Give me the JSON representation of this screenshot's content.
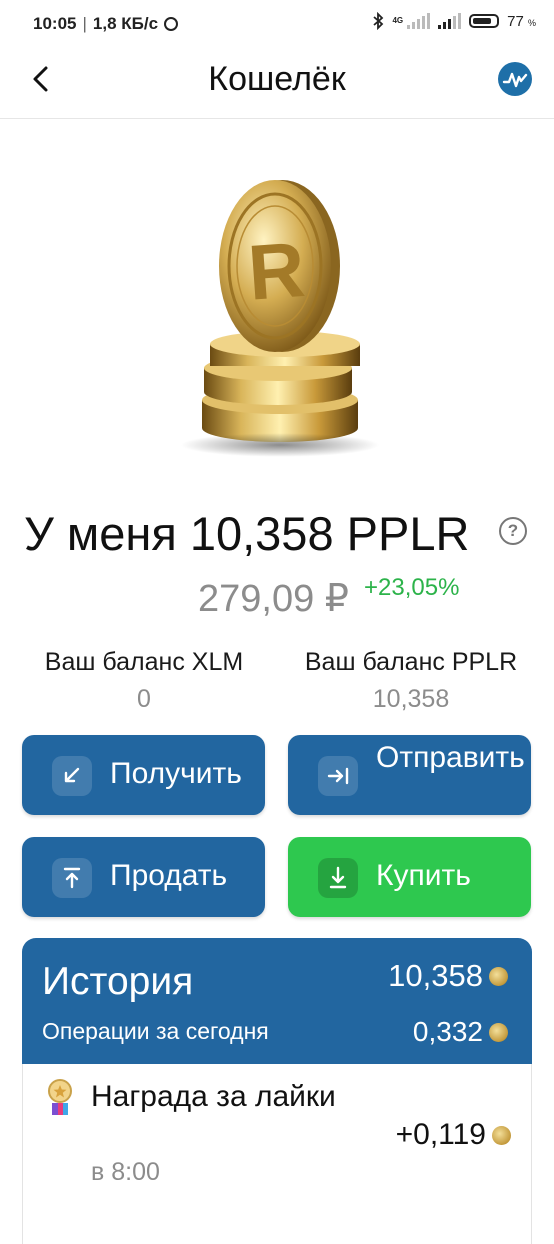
{
  "statusbar": {
    "time": "10:05",
    "speed": "1,8 КБ/с",
    "network": "4G",
    "battery": "77",
    "battery_unit": "%"
  },
  "header": {
    "title": "Кошелёк"
  },
  "wallet": {
    "balance_text": "У меня 10,358 PPLR",
    "help_symbol": "?",
    "rub_value": "279,09 ₽",
    "change": "+23,05%",
    "xlm_label": "Ваш баланс XLM",
    "xlm_value": "0",
    "pplr_label": "Ваш баланс PPLR",
    "pplr_value": "10,358"
  },
  "actions": {
    "receive": "Получить",
    "send": "Отправить",
    "sell": "Продать",
    "buy": "Купить"
  },
  "history": {
    "title": "История",
    "total": "10,358",
    "today_label": "Операции за сегодня",
    "today_value": "0,332",
    "items": [
      {
        "title": "Награда за лайки",
        "amount": "+0,119",
        "time": "в 8:00"
      }
    ]
  },
  "colors": {
    "primary": "#2266a0",
    "buy": "#2ec84f",
    "positive": "#2cb34a",
    "muted": "#8c8c8c"
  },
  "icons": {
    "back": "arrow-left-icon",
    "stats": "pulse-chart-icon",
    "receive": "arrow-down-left-icon",
    "send": "arrow-right-bar-icon",
    "sell": "arrow-up-bar-icon",
    "buy": "download-icon"
  }
}
